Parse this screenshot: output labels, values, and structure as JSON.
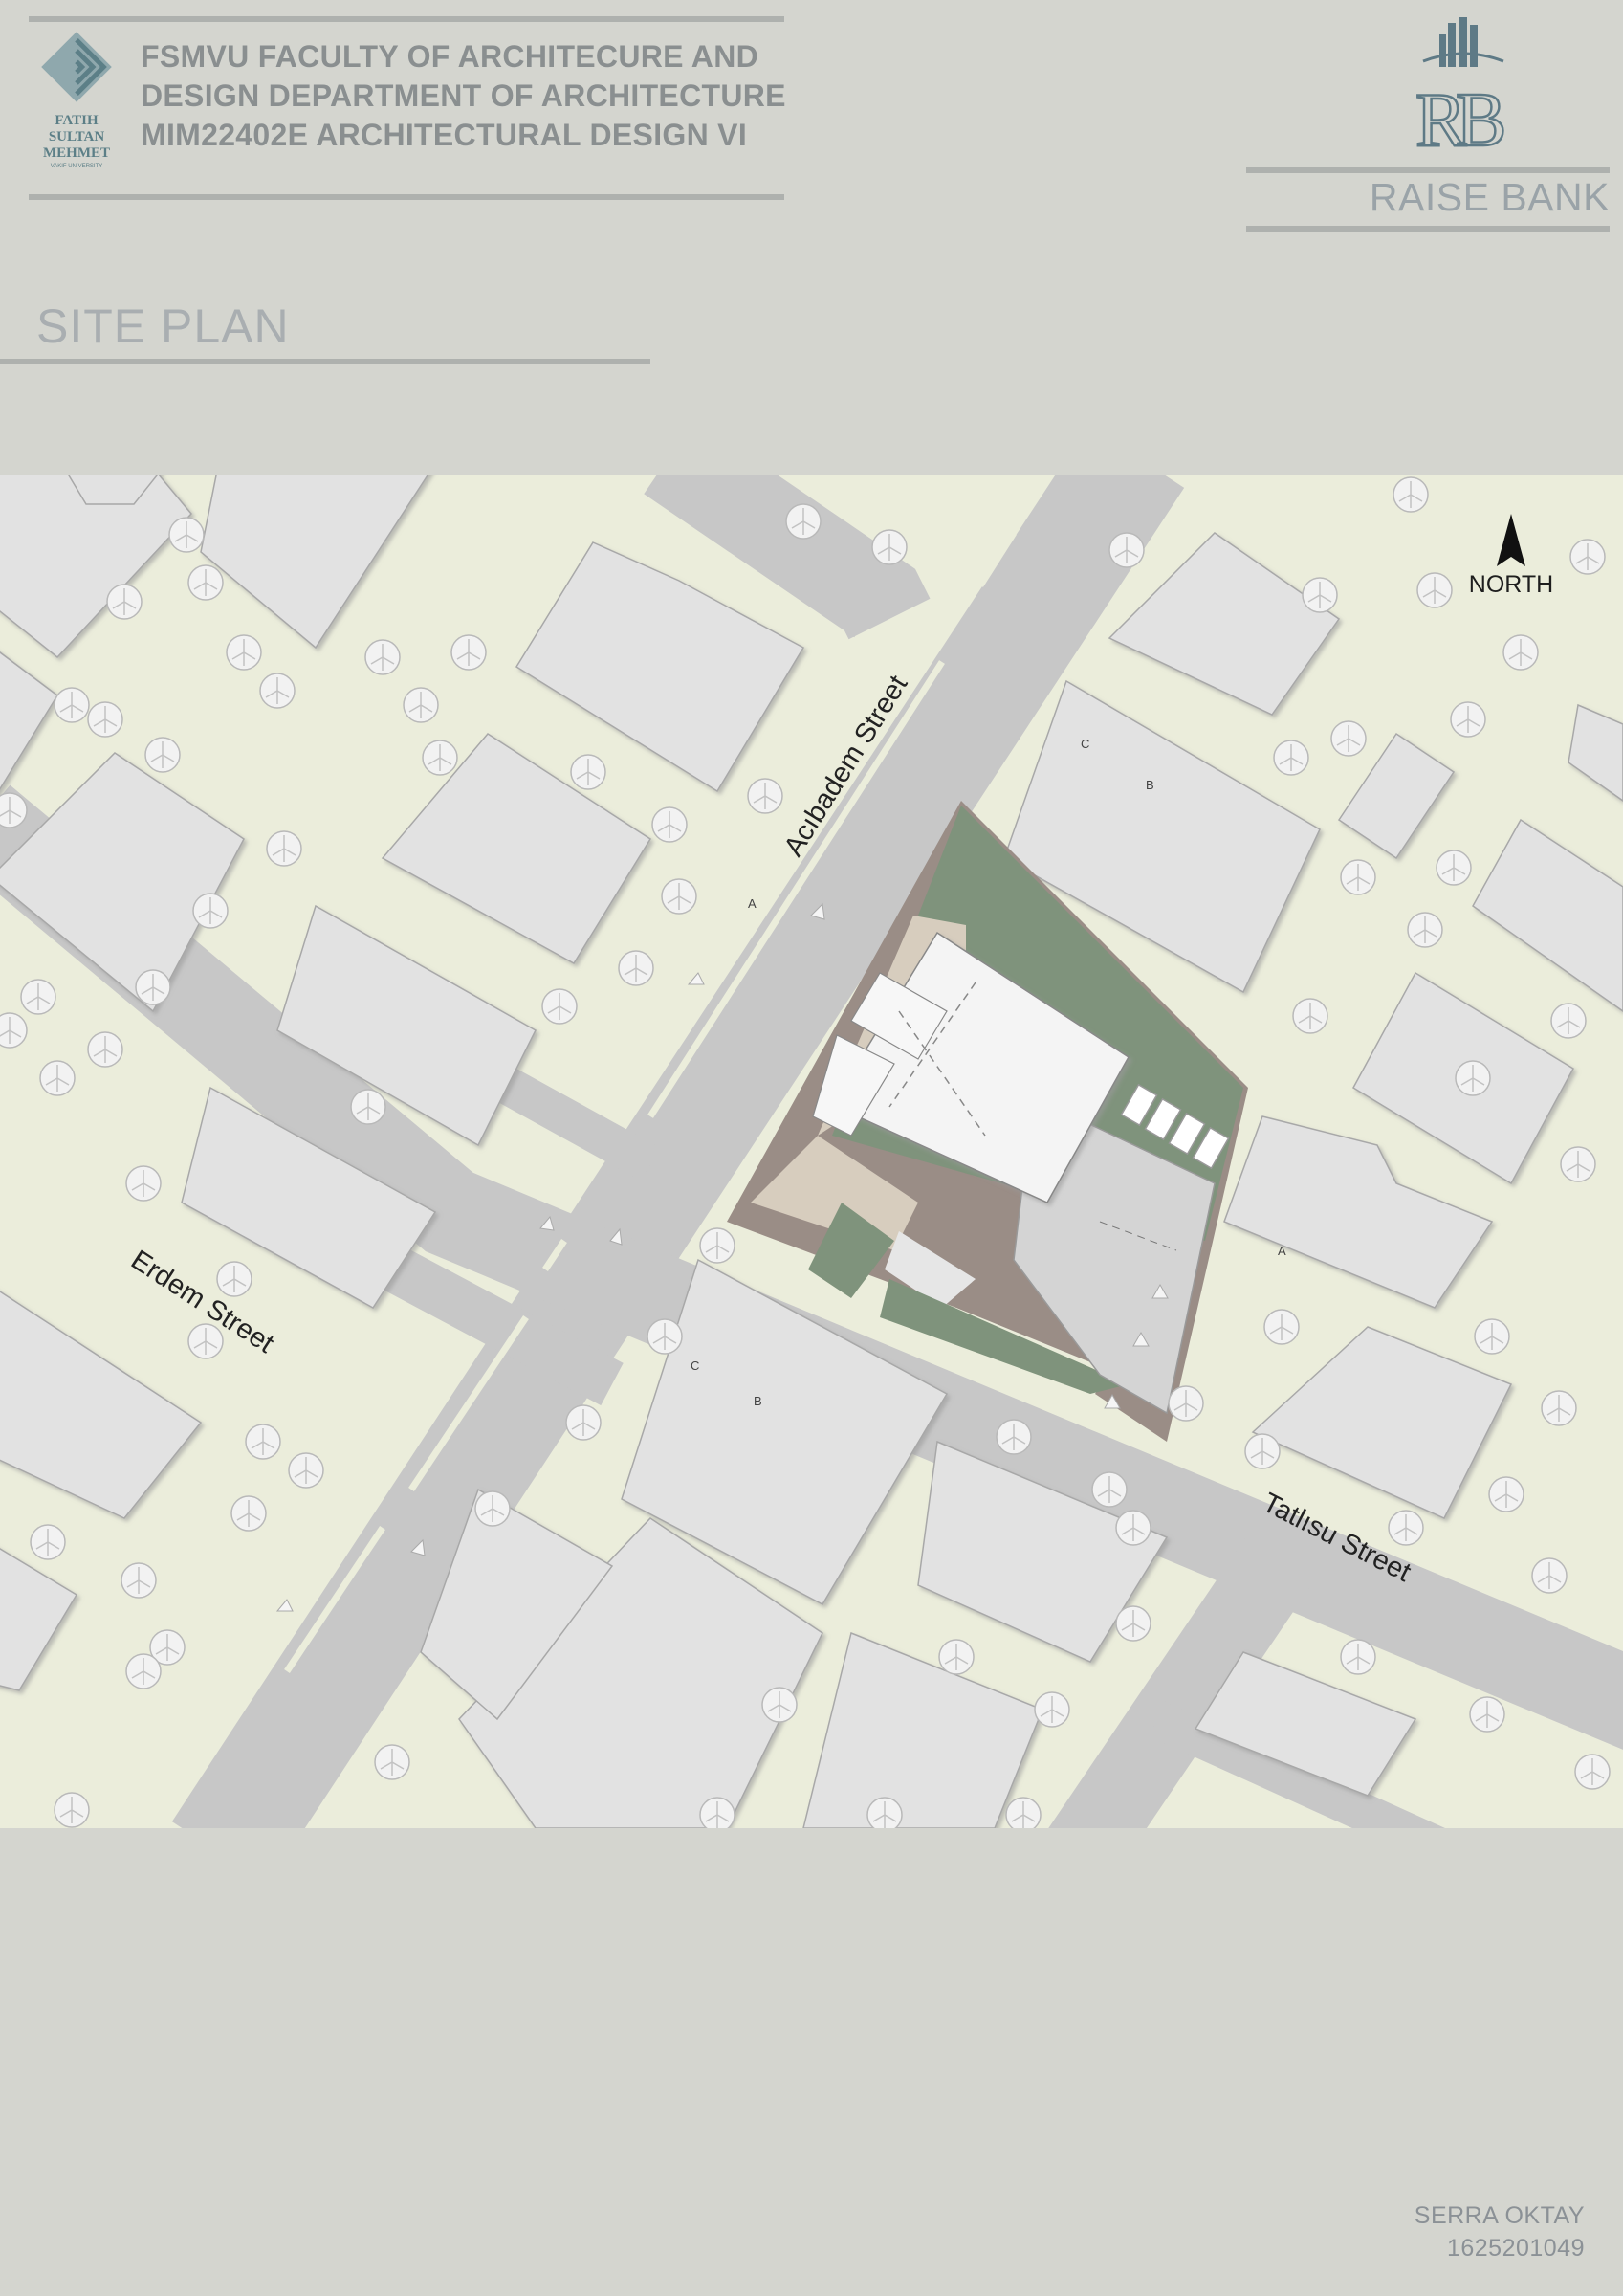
{
  "header": {
    "lines": [
      "FSMVU FACULTY OF ARCHITECURE AND",
      "DESIGN DEPARTMENT OF ARCHITECTURE",
      "MIM22402E ARCHITECTURAL DESIGN VI"
    ],
    "university_logo": {
      "icon": "fsmvu-logo-icon",
      "lines": [
        "FATIH",
        "SULTAN",
        "MEHMET"
      ],
      "small": "VAKIF UNIVERSITY"
    }
  },
  "project": {
    "logo_icon": "raise-bank-logo-icon",
    "name": "RAISE BANK"
  },
  "section_title": "SITE PLAN",
  "map": {
    "streets": {
      "acibadem": "Acıbadem Street",
      "erdem": "Erdem Street",
      "tatlisu": "Tatlısu Street"
    },
    "north_label": "NORTH",
    "section_marks": {
      "c": "C",
      "b": "B",
      "a": "A"
    },
    "colors": {
      "background": "#ebeddb",
      "road": "#c8c8c8",
      "building": "#e2e2e2",
      "building_stroke": "#a8a8a8",
      "green": "#7f937c",
      "site_paving": "#d7cdbe",
      "sidewalk": "#9a8d86",
      "proposed_building": "#f4f4f4"
    }
  },
  "author": {
    "name": "SERRA OKTAY",
    "id": "1625201049"
  }
}
